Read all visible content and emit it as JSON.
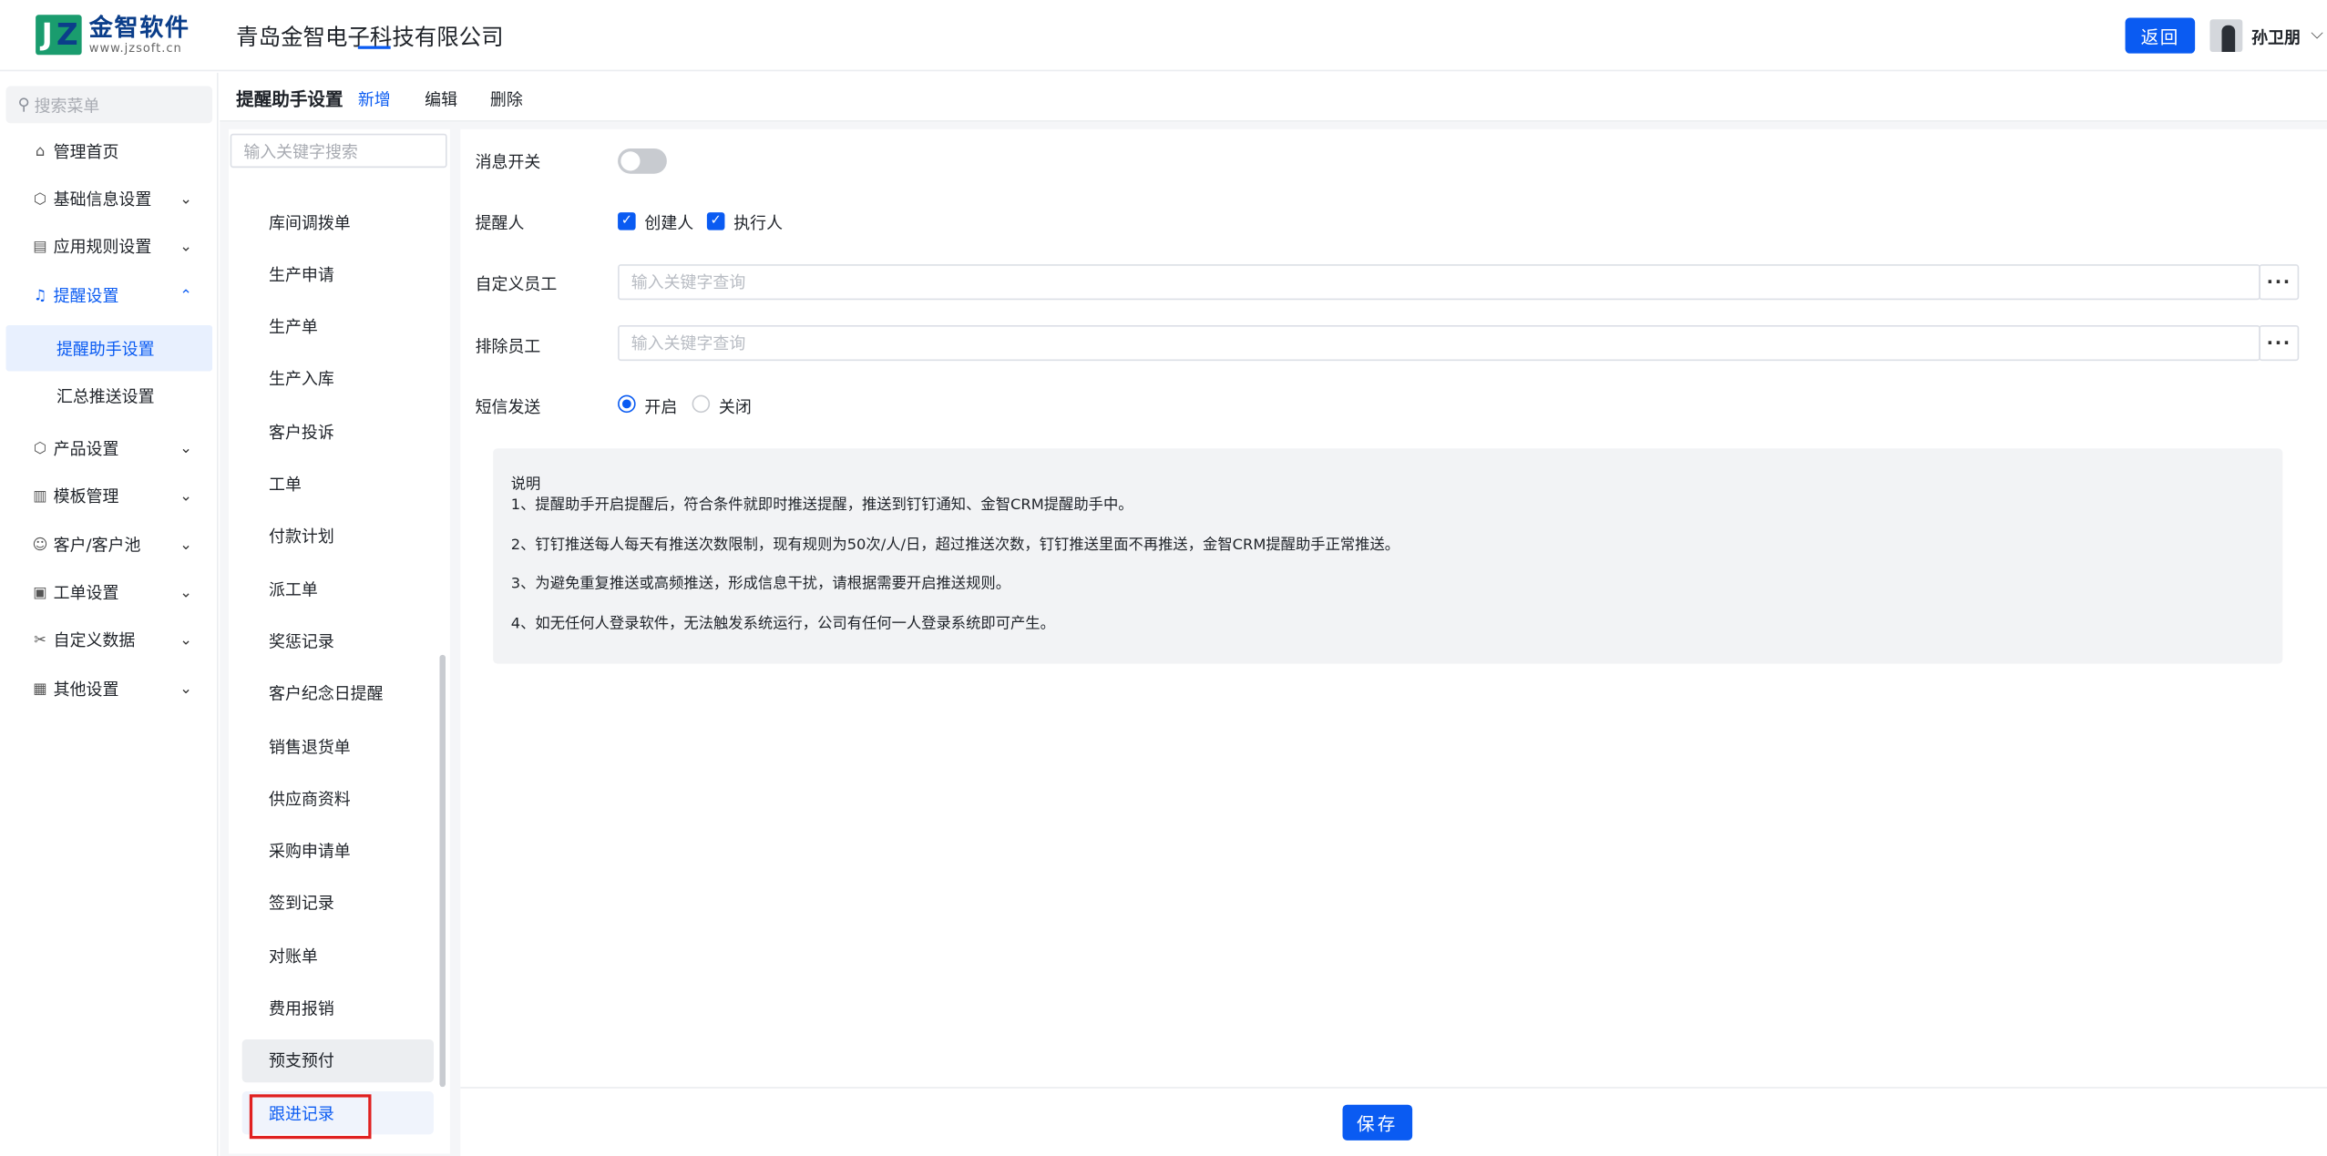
{
  "header": {
    "logo_name": "金智软件",
    "logo_url": "www.jzsoft.cn",
    "company": "青岛金智电子科技有限公司",
    "back_label": "返回",
    "username": "孙卫朋"
  },
  "sidebar": {
    "search_placeholder": "搜索菜单",
    "items": [
      {
        "label": "管理首页",
        "icon": "home-icon"
      },
      {
        "label": "基础信息设置",
        "icon": "cube-icon"
      },
      {
        "label": "应用规则设置",
        "icon": "document-icon"
      },
      {
        "label": "提醒设置",
        "icon": "bell-icon"
      },
      {
        "label": "产品设置",
        "icon": "cube-icon"
      },
      {
        "label": "模板管理",
        "icon": "layout-icon"
      },
      {
        "label": "客户/客户池",
        "icon": "users-icon"
      },
      {
        "label": "工单设置",
        "icon": "clipboard-icon"
      },
      {
        "label": "自定义数据",
        "icon": "tools-icon"
      },
      {
        "label": "其他设置",
        "icon": "grid-icon"
      }
    ],
    "sub_items": [
      {
        "label": "提醒助手设置"
      },
      {
        "label": "汇总推送设置"
      }
    ],
    "active_color": "#0a5bf2"
  },
  "tabs": {
    "title": "提醒助手设置",
    "items": [
      {
        "label": "新增"
      },
      {
        "label": "编辑"
      },
      {
        "label": "删除"
      }
    ]
  },
  "list": {
    "search_placeholder": "输入关键字搜索",
    "items": [
      "库间调拨单",
      "生产申请",
      "生产单",
      "生产入库",
      "客户投诉",
      "工单",
      "付款计划",
      "派工单",
      "奖惩记录",
      "客户纪念日提醒",
      "销售退货单",
      "供应商资料",
      "采购申请单",
      "签到记录",
      "对账单",
      "费用报销",
      "预支预付",
      "跟进记录"
    ]
  },
  "form": {
    "switch_label": "消息开关",
    "switch_on": false,
    "reminder_label": "提醒人",
    "reminder_options": [
      {
        "label": "创建人",
        "checked": true
      },
      {
        "label": "执行人",
        "checked": true
      }
    ],
    "custom_staff_label": "自定义员工",
    "custom_staff_placeholder": "输入关键字查询",
    "exclude_staff_label": "排除员工",
    "exclude_staff_placeholder": "输入关键字查询",
    "more_label": "···",
    "sms_label": "短信发送",
    "sms_options": [
      {
        "label": "开启",
        "selected": true
      },
      {
        "label": "关闭",
        "selected": false
      }
    ]
  },
  "note": {
    "title": "说明",
    "lines": [
      "1、提醒助手开启提醒后，符合条件就即时推送提醒，推送到钉钉通知、金智CRM提醒助手中。",
      "2、钉钉推送每人每天有推送次数限制，现有规则为50次/人/日，超过推送次数，钉钉推送里面不再推送，金智CRM提醒助手正常推送。",
      "3、为避免重复推送或高频推送，形成信息干扰，请根据需要开启推送规则。",
      "4、如无任何人登录软件，无法触发系统运行，公司有任何一人登录系统即可产生。"
    ]
  },
  "footer": {
    "save_label": "保存"
  }
}
